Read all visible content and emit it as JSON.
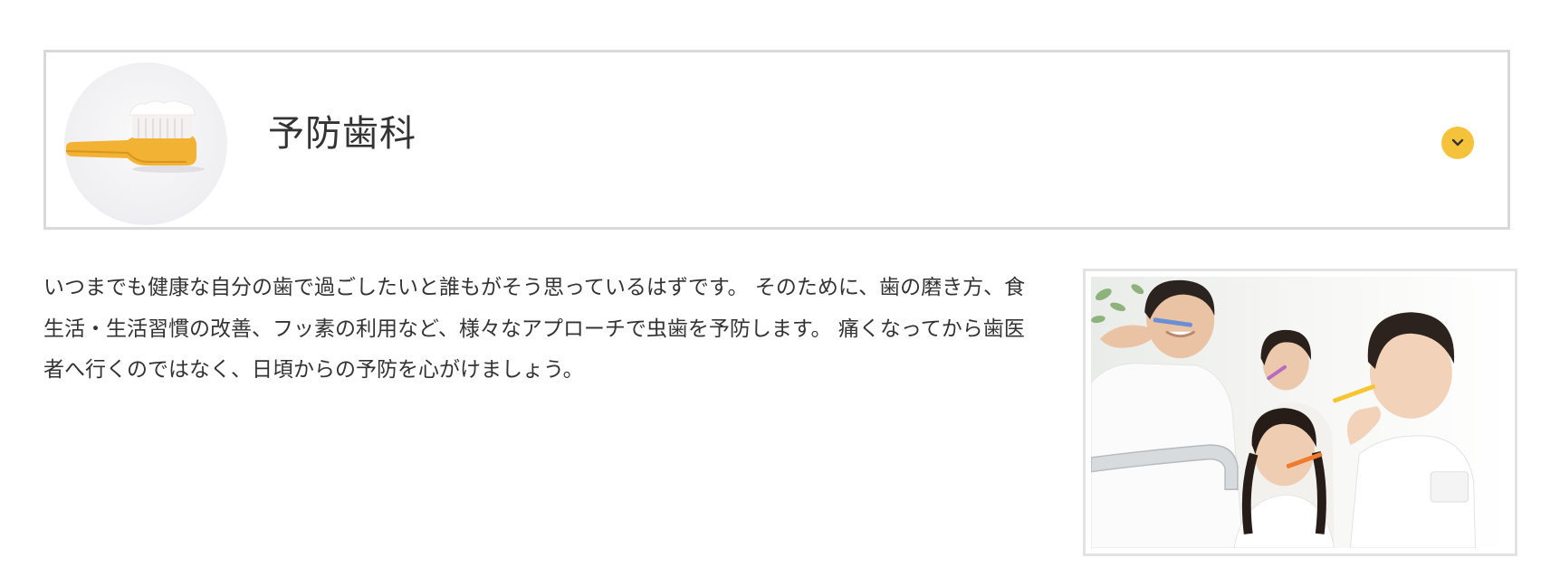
{
  "section": {
    "title": "予防歯科",
    "toggle_icon": "chevron-down-icon",
    "accent_color": "#f5c33b",
    "thumbnail_icon": "toothbrush-icon"
  },
  "content": {
    "description": "いつまでも健康な自分の歯で過ごしたいと誰もがそう思っているはずです。 そのために、歯の磨き方、食生活・生活習慣の改善、フッ素の利用など、様々なアプローチで虫歯を予防します。 痛くなってから歯医者へ行くのではなく、日頃からの予防を心がけましょう。"
  }
}
